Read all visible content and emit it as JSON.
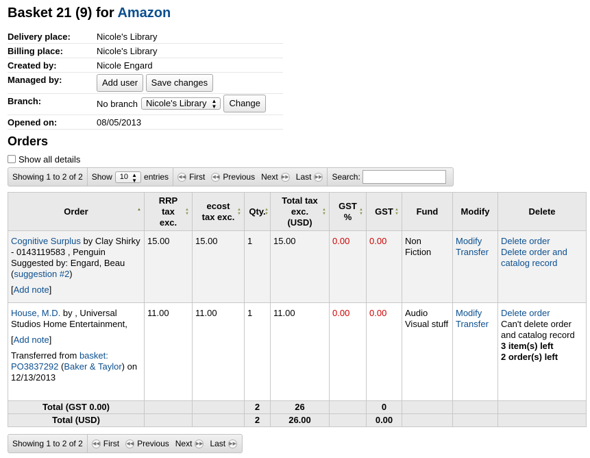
{
  "header": {
    "title_prefix": "Basket 21 (9) for",
    "vendor": "Amazon"
  },
  "info": {
    "delivery_label": "Delivery place:",
    "delivery_value": "Nicole's Library",
    "billing_label": "Billing place:",
    "billing_value": "Nicole's Library",
    "created_label": "Created by:",
    "created_value": "Nicole Engard",
    "managed_label": "Managed by:",
    "add_user": "Add user",
    "save_changes": "Save changes",
    "branch_label": "Branch:",
    "branch_value": "No branch",
    "branch_select": "Nicole's Library",
    "change_button": "Change",
    "opened_label": "Opened on:",
    "opened_value": "08/05/2013"
  },
  "orders_heading": "Orders",
  "show_all_details": "Show all details",
  "toolbar_top": {
    "info": "Showing 1 to 2 of 2",
    "show_label": "Show",
    "entries_value": "10",
    "entries_label": "entries",
    "first": "First",
    "previous": "Previous",
    "next": "Next",
    "last": "Last",
    "search_label": "Search:"
  },
  "table": {
    "headers": [
      "Order",
      "RRP tax exc.",
      "ecost tax exc.",
      "Qty.",
      "Total tax exc. (USD)",
      "GST %",
      "GST",
      "Fund",
      "Modify",
      "Delete"
    ],
    "rows": [
      {
        "title": "Cognitive Surplus",
        "by_text": " by Clay Shirky - 0143119583 , Penguin",
        "suggested_text": "Suggested by: Engard, Beau",
        "suggestion_open": "(",
        "suggestion_link": "suggestion #2",
        "suggestion_close": ")",
        "note_open": "[",
        "note_link": "Add note",
        "note_close": "]",
        "rrp": "15.00",
        "ecost": "15.00",
        "qty": "1",
        "total": "15.00",
        "gst_pct": "0.00",
        "gst": "0.00",
        "fund": "Non Fiction",
        "modify": "Modify",
        "transfer": "Transfer",
        "delete_order": "Delete order",
        "delete_catalog": "Delete order and catalog record"
      },
      {
        "title": "House, M.D.",
        "by_text": " by , Universal Studios Home Entertainment,",
        "note_open": "[",
        "note_link": "Add note",
        "note_close": "]",
        "transfer_prefix": "Transferred from ",
        "transfer_basket": "basket: PO3837292",
        "transfer_vendor": "Baker & Taylor",
        "transfer_date": " on 12/13/2013",
        "rrp": "11.00",
        "ecost": "11.00",
        "qty": "1",
        "total": "11.00",
        "gst_pct": "0.00",
        "gst": "0.00",
        "fund": "Audio Visual stuff",
        "modify": "Modify",
        "transfer": "Transfer",
        "delete_order": "Delete order",
        "cant_delete": "Can't delete order and catalog record",
        "items_left": "3 item(s) left",
        "orders_left": "2 order(s) left"
      }
    ],
    "footer": [
      {
        "label": "Total (GST 0.00)",
        "qty": "2",
        "total": "26",
        "gst": "0"
      },
      {
        "label": "Total (USD)",
        "qty": "2",
        "total": "26.00",
        "gst": "0.00"
      }
    ]
  },
  "toolbar_bottom": {
    "info": "Showing 1 to 2 of 2",
    "first": "First",
    "previous": "Previous",
    "next": "Next",
    "last": "Last"
  },
  "colors": {
    "link": "#0b4f8f",
    "red_value": "#cc0000",
    "header_bg": "#e9e9e9"
  },
  "icons": [
    "sort-ascending-icon",
    "sort-both-icon",
    "first-page-icon",
    "previous-page-icon",
    "next-page-icon",
    "last-page-icon",
    "select-arrows-icon"
  ]
}
